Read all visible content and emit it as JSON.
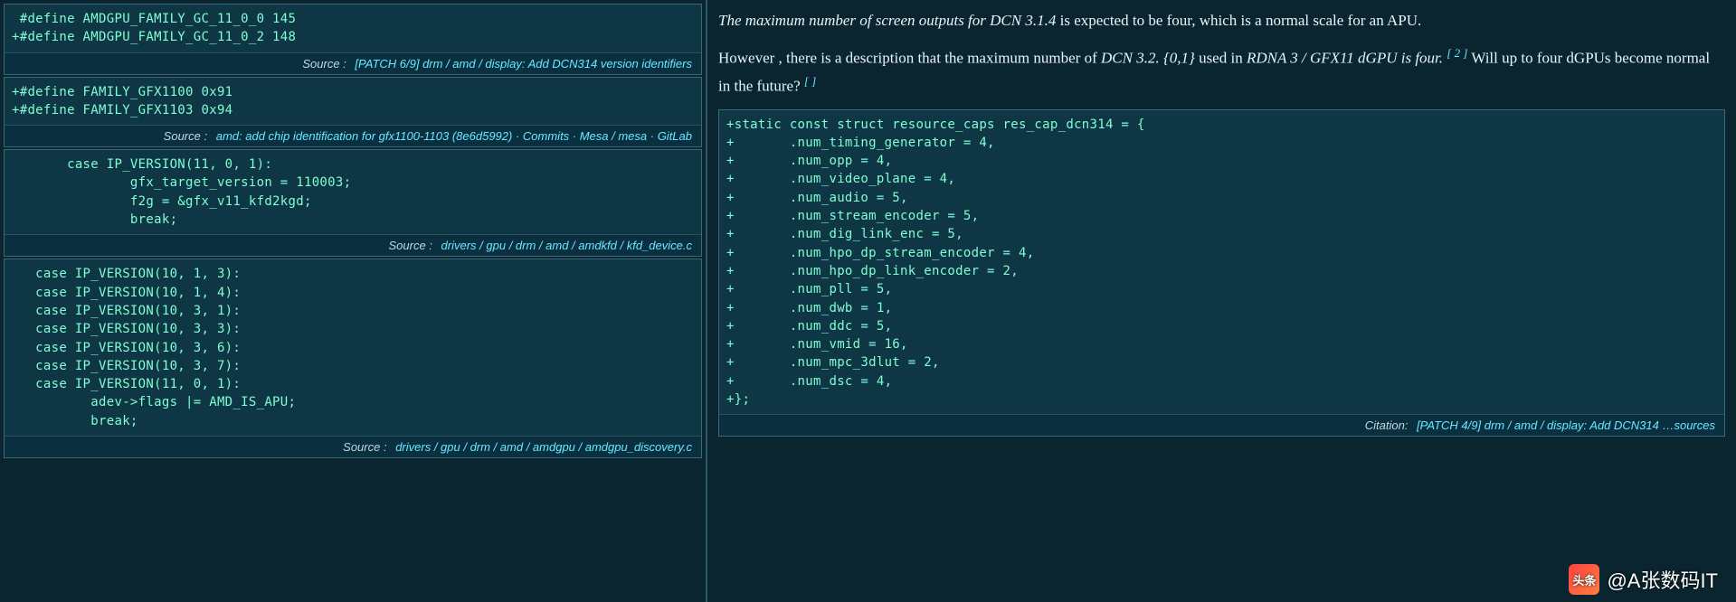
{
  "left": {
    "panel1": {
      "code": " #define AMDGPU_FAMILY_GC_11_0_0 145\n+#define AMDGPU_FAMILY_GC_11_0_2 148",
      "source_label": "Source :",
      "source_link": "[PATCH 6/9] drm / amd / display: Add DCN314 version identifiers"
    },
    "panel2": {
      "code": "+#define FAMILY_GFX1100 0x91\n+#define FAMILY_GFX1103 0x94",
      "source_label": "Source :",
      "source_link": "amd: add chip identification for gfx1100-1103 (8e6d5992) · Commits · Mesa / mesa · GitLab"
    },
    "panel3": {
      "code": "       case IP_VERSION(11, 0, 1):\n               gfx_target_version = 110003;\n               f2g = &gfx_v11_kfd2kgd;\n               break;",
      "source_label": "Source :",
      "source_link": "drivers / gpu / drm / amd / amdkfd / kfd_device.c"
    },
    "panel4": {
      "code": "   case IP_VERSION(10, 1, 3):\n   case IP_VERSION(10, 1, 4):\n   case IP_VERSION(10, 3, 1):\n   case IP_VERSION(10, 3, 3):\n   case IP_VERSION(10, 3, 6):\n   case IP_VERSION(10, 3, 7):\n   case IP_VERSION(11, 0, 1):\n          adev->flags |= AMD_IS_APU;\n          break;",
      "source_label": "Source :",
      "source_link": "drivers / gpu / drm / amd / amdgpu / amdgpu_discovery.c"
    }
  },
  "right": {
    "prose": {
      "s1a": "The maximum number of screen outputs for DCN 3.1.4",
      "s1b": " is expected to be four, which is a normal scale for an APU.",
      "s2a": "However , there is a description that the maximum number of ",
      "s2b": "DCN 3.2. {0,1}",
      "s2c": " used in ",
      "s2d": "RDNA 3 / GFX11 dGPU is four.",
      "ref1": "[ 2 ]",
      "s2e": "  Will up to four dGPUs become normal in the future?  ",
      "ref2": "[ ]"
    },
    "code": "+static const struct resource_caps res_cap_dcn314 = {\n+       .num_timing_generator = 4,\n+       .num_opp = 4,\n+       .num_video_plane = 4,\n+       .num_audio = 5,\n+       .num_stream_encoder = 5,\n+       .num_dig_link_enc = 5,\n+       .num_hpo_dp_stream_encoder = 4,\n+       .num_hpo_dp_link_encoder = 2,\n+       .num_pll = 5,\n+       .num_dwb = 1,\n+       .num_ddc = 5,\n+       .num_vmid = 16,\n+       .num_mpc_3dlut = 2,\n+       .num_dsc = 4,\n+};",
    "citation_label": "Citation:",
    "citation_link": "[PATCH 4/9] drm / amd / display: Add DCN314 …sources"
  },
  "watermark": {
    "logo": "头条",
    "text": "@A张数码IT"
  }
}
